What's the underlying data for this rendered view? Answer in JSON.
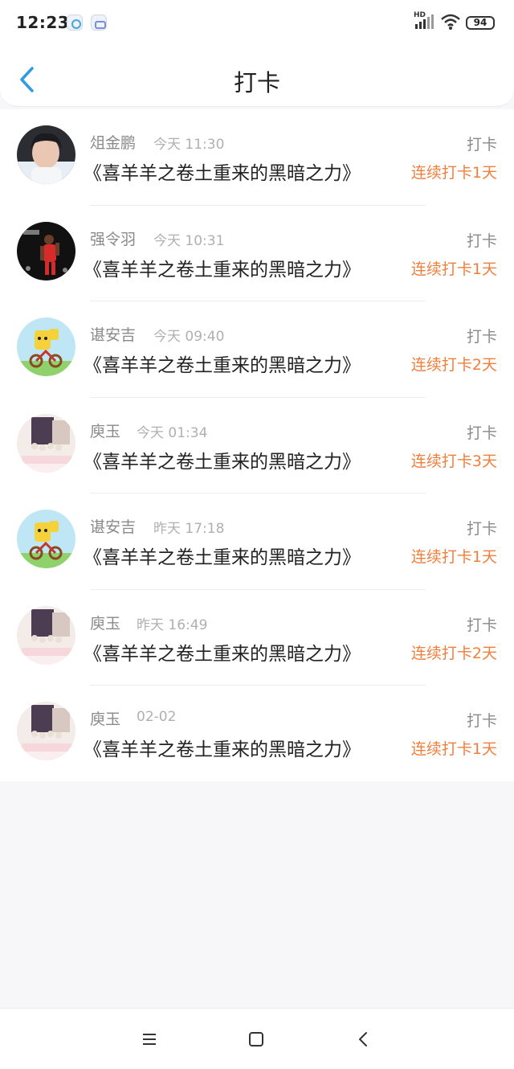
{
  "status_bar": {
    "time": "12:23",
    "signal_label": "HD",
    "battery": "94",
    "icons": [
      "app-notification-icon",
      "app-notification-icon",
      "signal-icon",
      "wifi-icon",
      "battery-icon"
    ]
  },
  "header": {
    "title": "打卡",
    "back_icon": "chevron-left-icon",
    "accent_color": "#2f9be3"
  },
  "checkins": [
    {
      "name": "俎金鹏",
      "time": "今天 11:30",
      "book": "《喜羊羊之卷土重来的黑暗之力》",
      "action": "打卡",
      "streak": "连续打卡1天"
    },
    {
      "name": "强令羽",
      "time": "今天 10:31",
      "book": "《喜羊羊之卷土重来的黑暗之力》",
      "action": "打卡",
      "streak": "连续打卡1天"
    },
    {
      "name": "谌安吉",
      "time": "今天 09:40",
      "book": "《喜羊羊之卷土重来的黑暗之力》",
      "action": "打卡",
      "streak": "连续打卡2天"
    },
    {
      "name": "庾玉",
      "time": "今天 01:34",
      "book": "《喜羊羊之卷土重来的黑暗之力》",
      "action": "打卡",
      "streak": "连续打卡3天"
    },
    {
      "name": "谌安吉",
      "time": "昨天 17:18",
      "book": "《喜羊羊之卷土重来的黑暗之力》",
      "action": "打卡",
      "streak": "连续打卡1天"
    },
    {
      "name": "庾玉",
      "time": "昨天 16:49",
      "book": "《喜羊羊之卷土重来的黑暗之力》",
      "action": "打卡",
      "streak": "连续打卡2天"
    },
    {
      "name": "庾玉",
      "time": "02-02",
      "book": "《喜羊羊之卷土重来的黑暗之力》",
      "action": "打卡",
      "streak": "连续打卡1天"
    }
  ],
  "colors": {
    "streak": "#f07f3c",
    "name": "#8a8a8a",
    "time": "#b0b0b0",
    "title": "#222222",
    "background": "#f7f6f8"
  },
  "nav_bar": {
    "icons": [
      "menu-icon",
      "home-square-icon",
      "back-chevron-icon"
    ]
  }
}
